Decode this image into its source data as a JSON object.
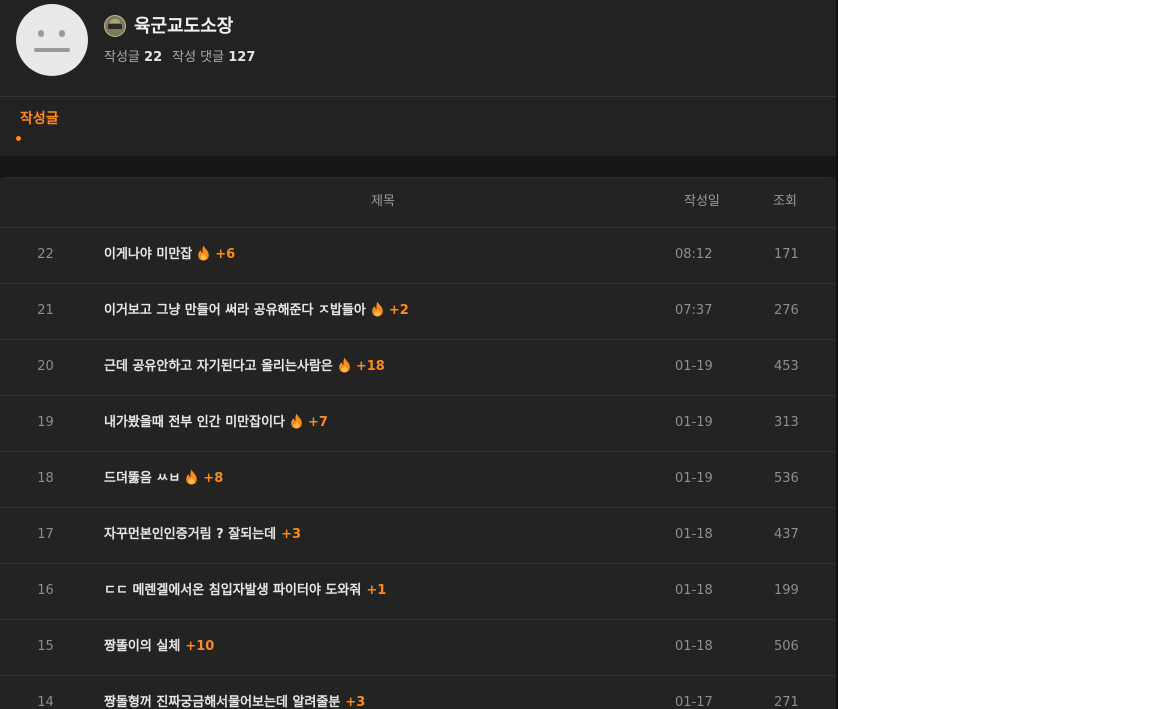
{
  "profile": {
    "nickname": "육군교도소장",
    "posts_label": "작성글",
    "posts_count": "22",
    "comments_label": "작성 댓글",
    "comments_count": "127"
  },
  "tabs": [
    {
      "label": "작성글",
      "active": true
    }
  ],
  "table": {
    "headers": {
      "title": "제목",
      "date": "작성일",
      "views": "조회"
    },
    "rows": [
      {
        "num": "22",
        "title": "이게나야 미만잡",
        "hot": true,
        "comments": "+6",
        "date": "08:12",
        "views": "171"
      },
      {
        "num": "21",
        "title": "이거보고 그냥 만들어 써라 공유해준다 ㅈ밥들아",
        "hot": true,
        "comments": "+2",
        "date": "07:37",
        "views": "276"
      },
      {
        "num": "20",
        "title": "근데 공유안하고 자기된다고 올리는사람은",
        "hot": true,
        "comments": "+18",
        "date": "01-19",
        "views": "453"
      },
      {
        "num": "19",
        "title": "내가봤을때 전부 인간 미만잡이다",
        "hot": true,
        "comments": "+7",
        "date": "01-19",
        "views": "313"
      },
      {
        "num": "18",
        "title": "드뎌뚫음 ㅆㅂ",
        "hot": true,
        "comments": "+8",
        "date": "01-19",
        "views": "536"
      },
      {
        "num": "17",
        "title": "자꾸먼본인인증거림 ? 잘되는데",
        "hot": false,
        "comments": "+3",
        "date": "01-18",
        "views": "437"
      },
      {
        "num": "16",
        "title": "ㄷㄷ 메렌겔에서온 침입자발생  파이터야 도와줘",
        "hot": false,
        "comments": "+1",
        "date": "01-18",
        "views": "199"
      },
      {
        "num": "15",
        "title": "짱똘이의 실체",
        "hot": false,
        "comments": "+10",
        "date": "01-18",
        "views": "506"
      },
      {
        "num": "14",
        "title": "짱돌형꺼 진짜궁금해서물어보는데 알려줄분",
        "hot": false,
        "comments": "+3",
        "date": "01-17",
        "views": "271"
      }
    ]
  },
  "colors": {
    "accent": "#ff8a1c",
    "background": "#1e1e1e"
  },
  "icons": {
    "avatar": "neutral-face-avatar",
    "level": "soldier-helmet-icon",
    "hot": "fire-icon"
  }
}
